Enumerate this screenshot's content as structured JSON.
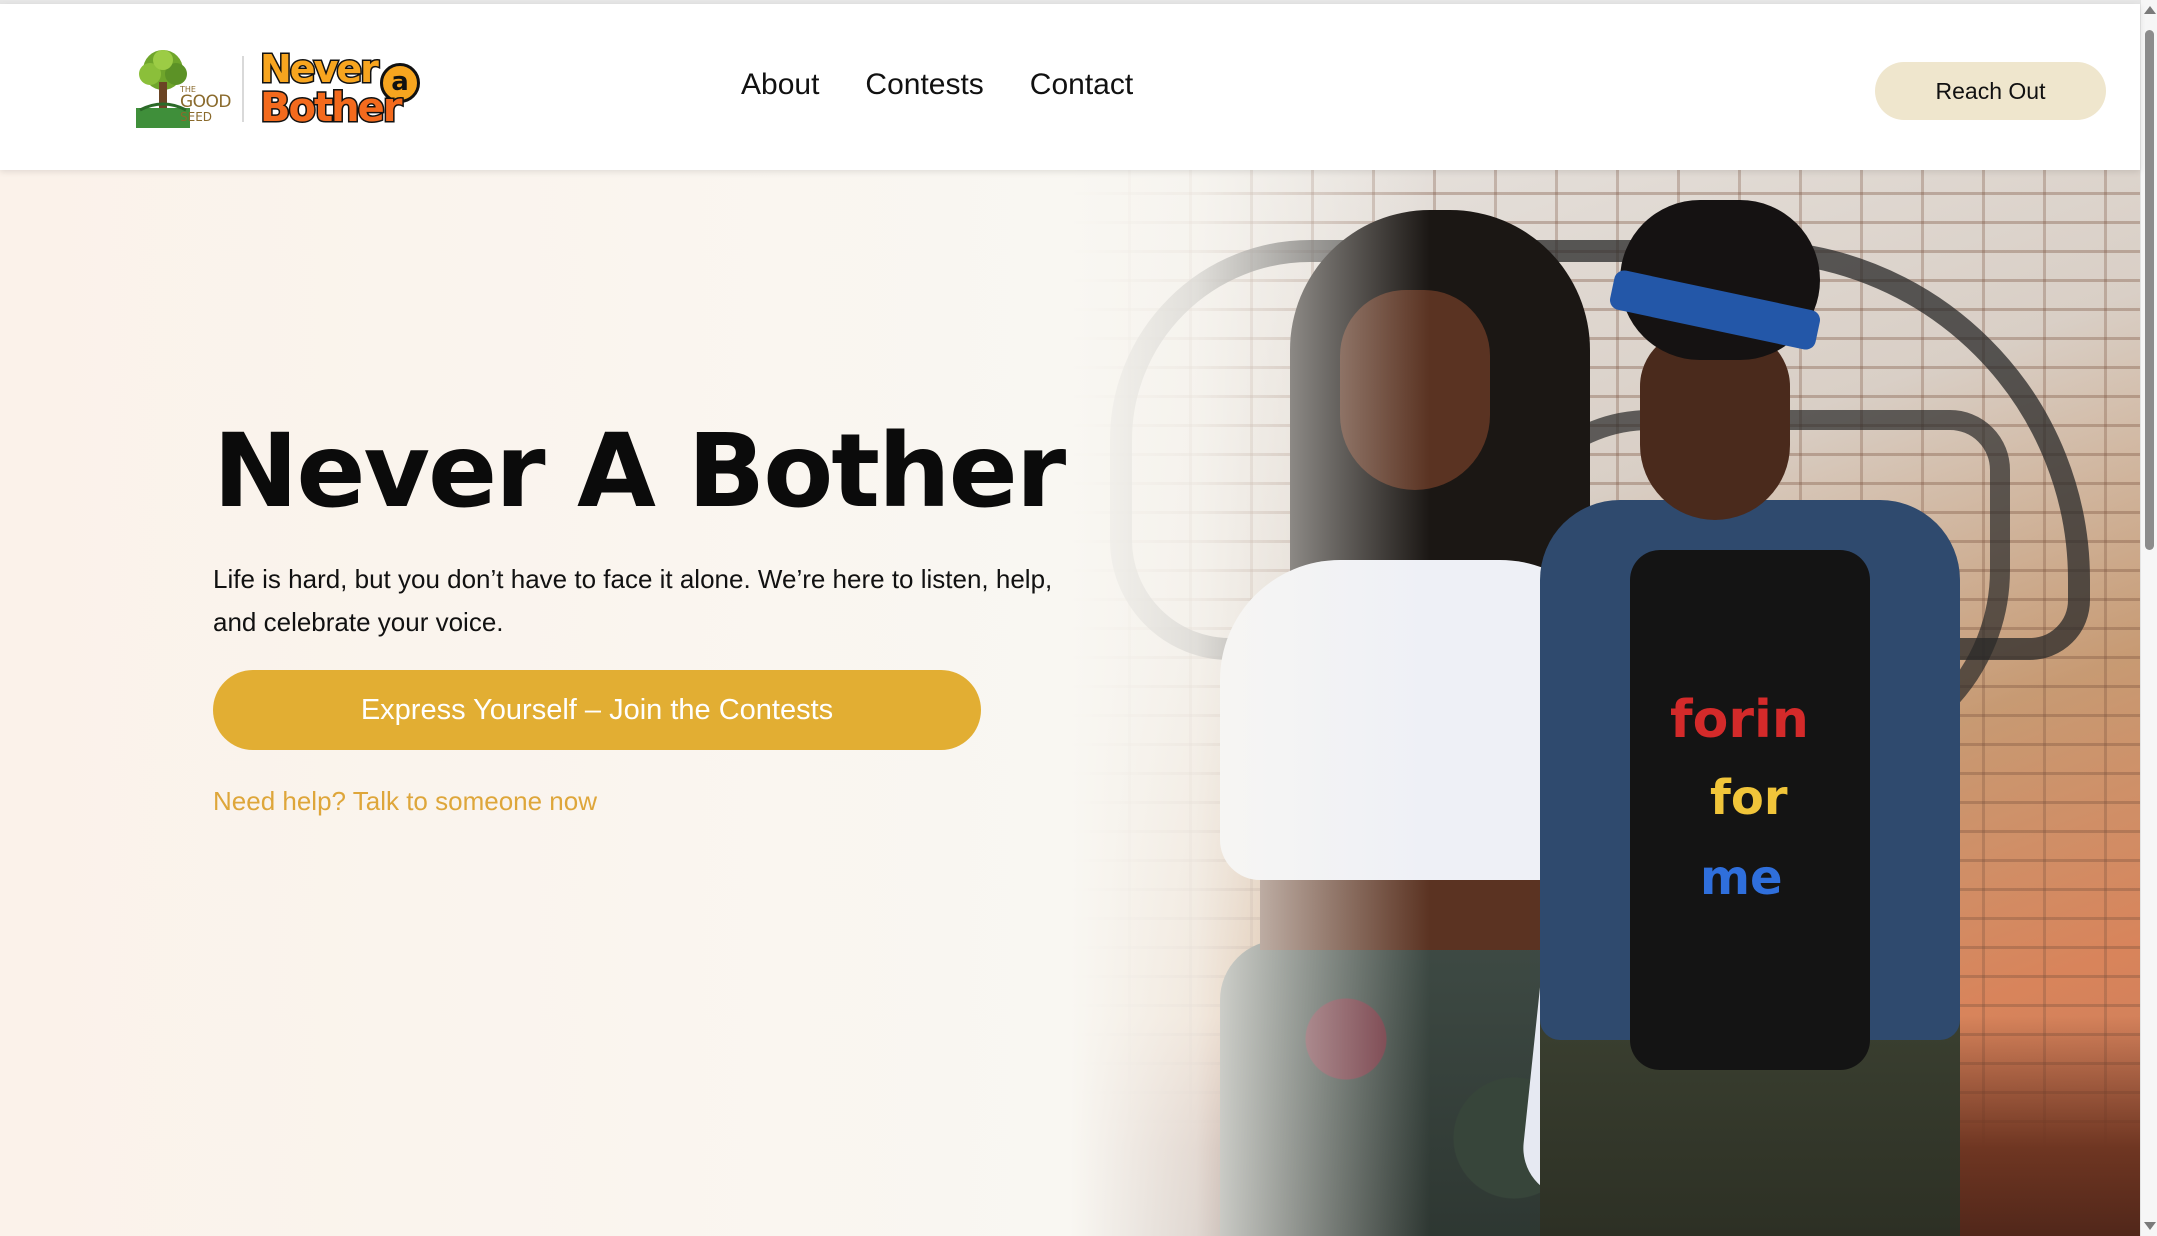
{
  "header": {
    "logo_good_seed": {
      "the": "THE",
      "good": "GOOD",
      "seed": "SEED"
    },
    "logo_never_a_bother": {
      "line1": "Never",
      "a": "a",
      "line2": "Bother"
    },
    "nav": [
      {
        "label": "About"
      },
      {
        "label": "Contests"
      },
      {
        "label": "Contact"
      }
    ],
    "reach_out_label": "Reach Out"
  },
  "hero": {
    "title": "Never A Bother",
    "subtitle": "Life is hard, but you don’t have to face it alone. We’re here to listen, help, and celebrate your voice.",
    "cta_label": "Express Yourself – Join the Contests",
    "help_link": "Need help? Talk to someone now",
    "image_alt": "hero-photo",
    "tee_text": {
      "line1": "forin",
      "line2": "for",
      "line3": "me"
    }
  },
  "colors": {
    "accent": "#e2ae33",
    "reach_out_bg": "#efe6cd",
    "help_link": "#dea63a",
    "hero_bg": "#f9f7f2"
  }
}
